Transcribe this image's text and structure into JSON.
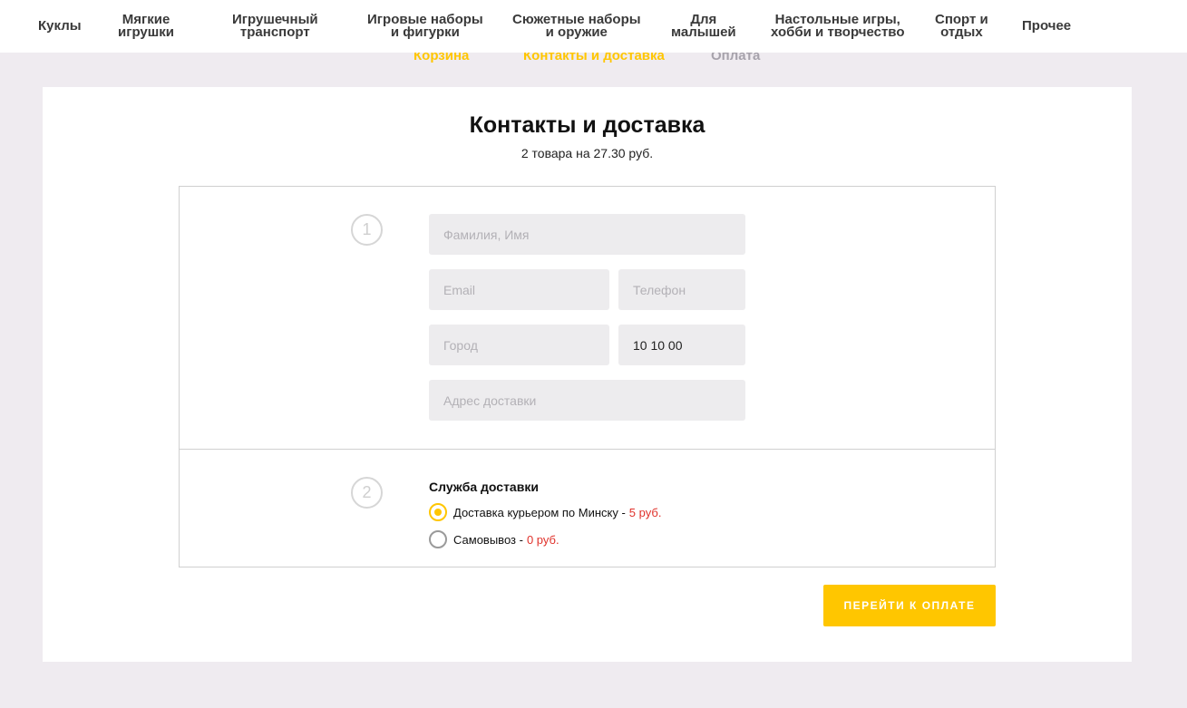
{
  "nav": {
    "items": [
      {
        "label": "Куклы"
      },
      {
        "label": "Мягкие\nигрушки"
      },
      {
        "label": "Игрушечный\nтранспорт"
      },
      {
        "label": "Игровые наборы\nи фигурки"
      },
      {
        "label": "Сюжетные наборы\nи оружие"
      },
      {
        "label": "Для\nмалышей"
      },
      {
        "label": "Настольные игры,\nхобби и творчество"
      },
      {
        "label": "Спорт и\nотдых"
      },
      {
        "label": "Прочее"
      }
    ]
  },
  "steps": {
    "cart": "Корзина",
    "contacts": "Контакты и доставка",
    "payment": "Оплата"
  },
  "page": {
    "title": "Контакты и доставка",
    "subtitle": "2 товара на 27.30 руб."
  },
  "contacts": {
    "step_number": "1",
    "name_placeholder": "Фамилия, Имя",
    "email_placeholder": "Email",
    "phone_placeholder": "Телефон",
    "city_placeholder": "Город",
    "postcode_value": "10 10 00",
    "address_placeholder": "Адрес доставки"
  },
  "delivery": {
    "step_number": "2",
    "heading": "Служба доставки",
    "options": [
      {
        "label": "Доставка курьером по Минску -",
        "price": "5 руб.",
        "selected": true
      },
      {
        "label": "Самовывоз -",
        "price": "0 руб.",
        "selected": false
      }
    ]
  },
  "actions": {
    "pay_button": "Перейти к оплате"
  },
  "colors": {
    "accent": "#ffc600",
    "price": "#e0322b",
    "background": "#efebf0"
  }
}
